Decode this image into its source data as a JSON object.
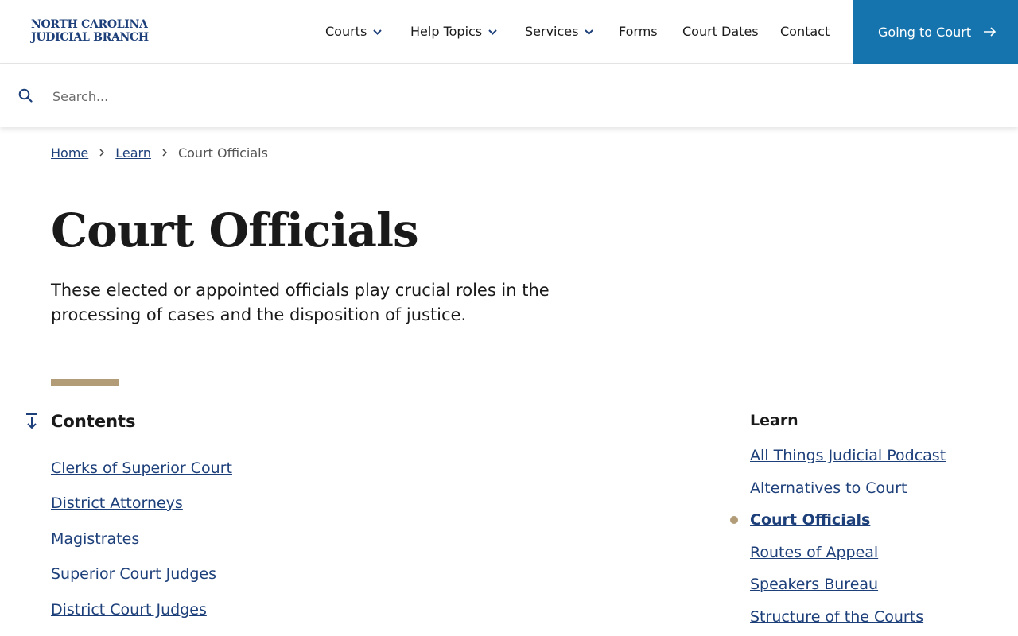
{
  "colors": {
    "brand_navy": "#1d3f7a",
    "cta_blue": "#1574ad",
    "accent_gold": "#b29c78",
    "text": "#1a1a1a"
  },
  "header": {
    "logo_line1": "NORTH CAROLINA",
    "logo_line2": "JUDICIAL BRANCH",
    "nav": [
      {
        "label": "Courts",
        "has_dropdown": true
      },
      {
        "label": "Help Topics",
        "has_dropdown": true
      },
      {
        "label": "Services",
        "has_dropdown": true
      },
      {
        "label": "Forms",
        "has_dropdown": false
      },
      {
        "label": "Court Dates",
        "has_dropdown": false
      },
      {
        "label": "Contact",
        "has_dropdown": false
      }
    ],
    "cta_label": "Going to Court",
    "cta_icon": "arrow-right-icon"
  },
  "search": {
    "placeholder": "Search...",
    "value": "",
    "icon": "search-icon"
  },
  "breadcrumb": {
    "items": [
      "Home",
      "Learn"
    ],
    "current": "Court Officials"
  },
  "main": {
    "title": "Court Officials",
    "intro": "These elected or appointed officials play crucial roles in the processing of cases and the disposition of justice.",
    "contents_heading": "Contents",
    "contents_icon": "arrow-down-to-line-icon",
    "contents": [
      "Clerks of Superior Court",
      "District Attorneys",
      "Magistrates",
      "Superior Court Judges",
      "District Court Judges"
    ]
  },
  "sidebar": {
    "heading": "Learn",
    "items": [
      {
        "label": "All Things Judicial Podcast",
        "active": false
      },
      {
        "label": "Alternatives to Court",
        "active": false
      },
      {
        "label": "Court Officials",
        "active": true
      },
      {
        "label": "Routes of Appeal",
        "active": false
      },
      {
        "label": "Speakers Bureau",
        "active": false
      },
      {
        "label": "Structure of the Courts",
        "active": false
      }
    ]
  }
}
